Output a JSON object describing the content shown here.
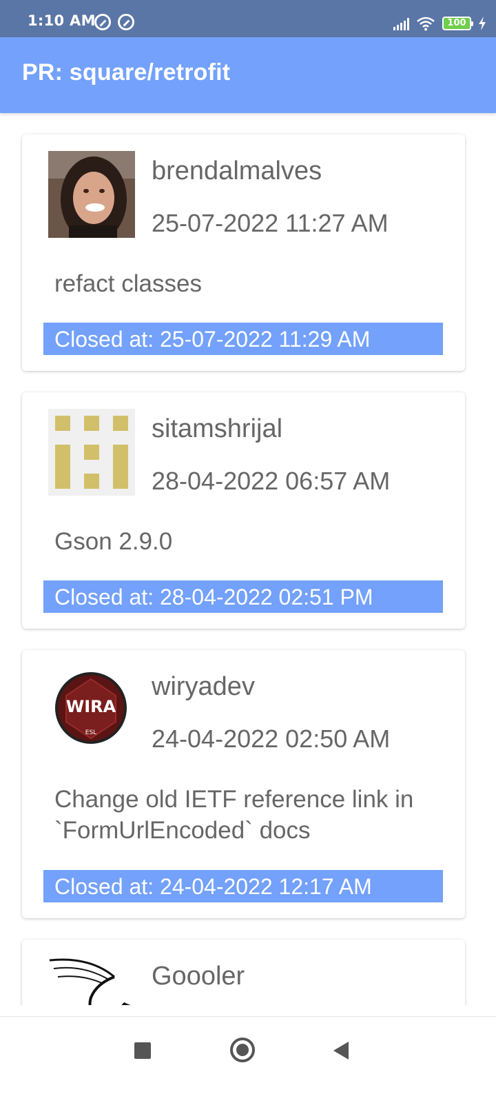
{
  "status_bar": {
    "time": "1:10 AM",
    "battery": "100",
    "icons": [
      "app-notification-icon",
      "app-notification-icon",
      "signal-icon",
      "wifi-icon",
      "battery-icon",
      "charging-icon"
    ]
  },
  "app_bar": {
    "title": "PR: square/retrofit"
  },
  "pull_requests": [
    {
      "username": "brendalmalves",
      "date": "25-07-2022 11:27 AM",
      "title": "refact classes",
      "closed": "Closed at: 25-07-2022 11:29 AM",
      "avatar": "user-photo-avatar"
    },
    {
      "username": "sitamshrijal",
      "date": "28-04-2022 06:57 AM",
      "title": "Gson 2.9.0",
      "closed": "Closed at: 28-04-2022 02:51 PM",
      "avatar": "identicon-avatar"
    },
    {
      "username": "wiryadev",
      "date": "24-04-2022 02:50 AM",
      "title": "Change old IETF reference link in `FormUrlEncoded` docs",
      "closed": "Closed at: 24-04-2022 12:17 AM",
      "avatar": "wira-logo-avatar",
      "avatar_text": "WIRA",
      "avatar_subtext": "ESL"
    },
    {
      "username": "Goooler",
      "avatar": "dragon-logo-avatar"
    }
  ],
  "nav_bar": {
    "buttons": [
      "recent-apps",
      "home",
      "back"
    ]
  },
  "colors": {
    "status_bar": "#5a76a6",
    "accent": "#73a1fb",
    "text": "#666666"
  }
}
